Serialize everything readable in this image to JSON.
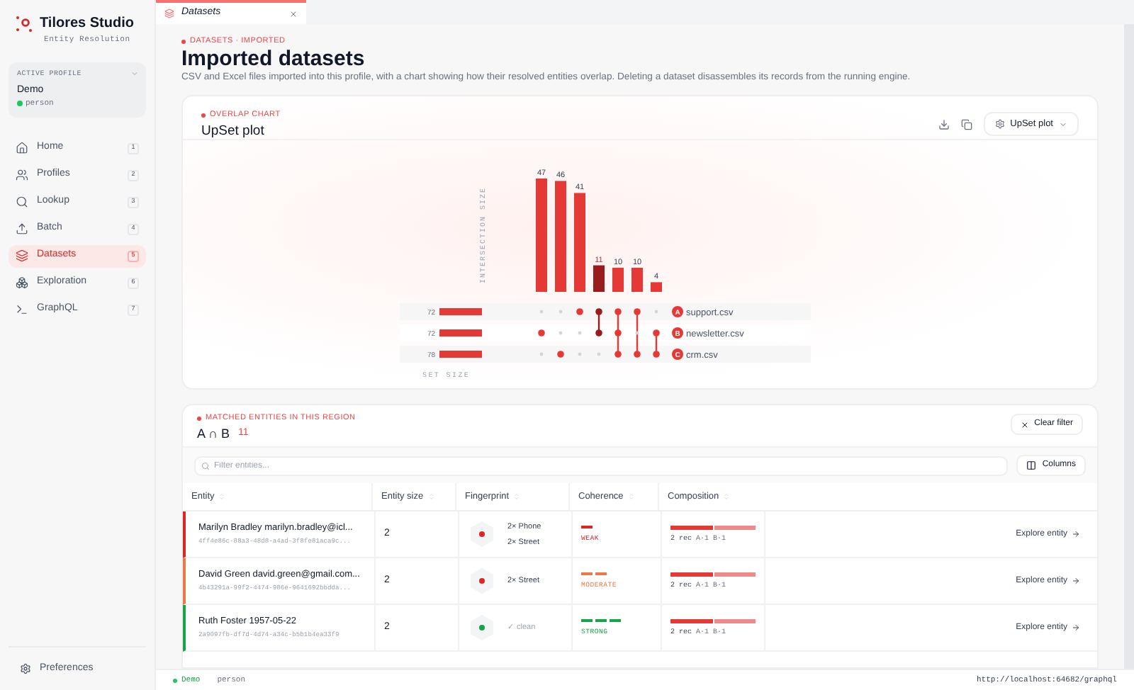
{
  "app": {
    "name": "Tilores Studio",
    "subtitle": "Entity Resolution"
  },
  "profile": {
    "label": "ACTIVE PROFILE",
    "name": "Demo",
    "type": "person"
  },
  "nav": [
    {
      "label": "Home",
      "key": "1",
      "selected": false
    },
    {
      "label": "Profiles",
      "key": "2",
      "selected": false
    },
    {
      "label": "Lookup",
      "key": "3",
      "selected": false
    },
    {
      "label": "Batch",
      "key": "4",
      "selected": false
    },
    {
      "label": "Datasets",
      "key": "5",
      "selected": true
    },
    {
      "label": "Exploration",
      "key": "6",
      "selected": false
    },
    {
      "label": "GraphQL",
      "key": "7",
      "selected": false
    }
  ],
  "preferences": "Preferences",
  "tabs": [
    {
      "label": "Datasets",
      "selected": true
    }
  ],
  "header": {
    "eyebrow": "DATASETS · IMPORTED",
    "title": "Imported datasets",
    "description": "CSV and Excel files imported into this profile, with a chart showing how their resolved entities overlap. Deleting a dataset disassembles its records from the running engine."
  },
  "chart_card": {
    "eyebrow": "OVERLAP CHART",
    "title": "UpSet plot",
    "view_select": "UpSet plot",
    "y_axis": "INTERSECTION SIZE",
    "set_axis": "SET SIZE",
    "intersections": [
      {
        "count": "47",
        "members": [
          false,
          true,
          false
        ],
        "selected": false
      },
      {
        "count": "46",
        "members": [
          false,
          false,
          true
        ],
        "selected": false
      },
      {
        "count": "41",
        "members": [
          true,
          false,
          false
        ],
        "selected": false
      },
      {
        "count": "11",
        "members": [
          true,
          true,
          false
        ],
        "selected": true
      },
      {
        "count": "10",
        "members": [
          true,
          true,
          true
        ],
        "selected": false
      },
      {
        "count": "10",
        "members": [
          true,
          false,
          true
        ],
        "selected": false
      },
      {
        "count": "4",
        "members": [
          false,
          true,
          true
        ],
        "selected": false
      }
    ],
    "sets": [
      {
        "letter": "A",
        "name": "support.csv",
        "size": "72"
      },
      {
        "letter": "B",
        "name": "newsletter.csv",
        "size": "72"
      },
      {
        "letter": "C",
        "name": "crm.csv",
        "size": "78"
      }
    ]
  },
  "matched": {
    "eyebrow": "MATCHED ENTITIES IN THIS REGION",
    "region": "A ∩ B",
    "count": "11",
    "clear_button": "Clear filter",
    "filter_placeholder": "Filter entities...",
    "columns_button": "Columns",
    "columns": [
      "Entity",
      "Entity size",
      "Fingerprint",
      "Coherence",
      "Composition"
    ],
    "rows": [
      {
        "name": "Marilyn Bradley marilyn.bradley@icl...",
        "id": "4ff4e86c-88a3-48d8-a4ad-3f8fe81aca9c...",
        "size": "2",
        "fingerprint": [
          "2× Phone",
          "2× Street"
        ],
        "clean": false,
        "coherence": "WEAK",
        "kind": "weak",
        "color": "#dc2626",
        "records": "2 rec",
        "parts": [
          "A·1",
          "B·1"
        ],
        "action": "Explore entity"
      },
      {
        "name": "David Green david.green@gmail.com...",
        "id": "4b43291a-99f2-4474-986e-9641692bbdda...",
        "size": "2",
        "fingerprint": [
          "2× Street"
        ],
        "clean": false,
        "coherence": "MODERATE",
        "kind": "moderate",
        "color": "#ea7a45",
        "records": "2 rec",
        "parts": [
          "A·1",
          "B·1"
        ],
        "action": "Explore entity"
      },
      {
        "name": "Ruth Foster 1957-05-22",
        "id": "2a9097fb-df7d-4d74-a34c-b5b1b4ea33f9",
        "size": "2",
        "fingerprint": [
          "✓ clean"
        ],
        "clean": true,
        "coherence": "STRONG",
        "kind": "strong",
        "color": "#16a34a",
        "records": "2 rec",
        "parts": [
          "A·1",
          "B·1"
        ],
        "action": "Explore entity"
      }
    ]
  },
  "status": {
    "profile": "Demo",
    "type": "person",
    "url": "http://localhost:64682/graphql"
  }
}
